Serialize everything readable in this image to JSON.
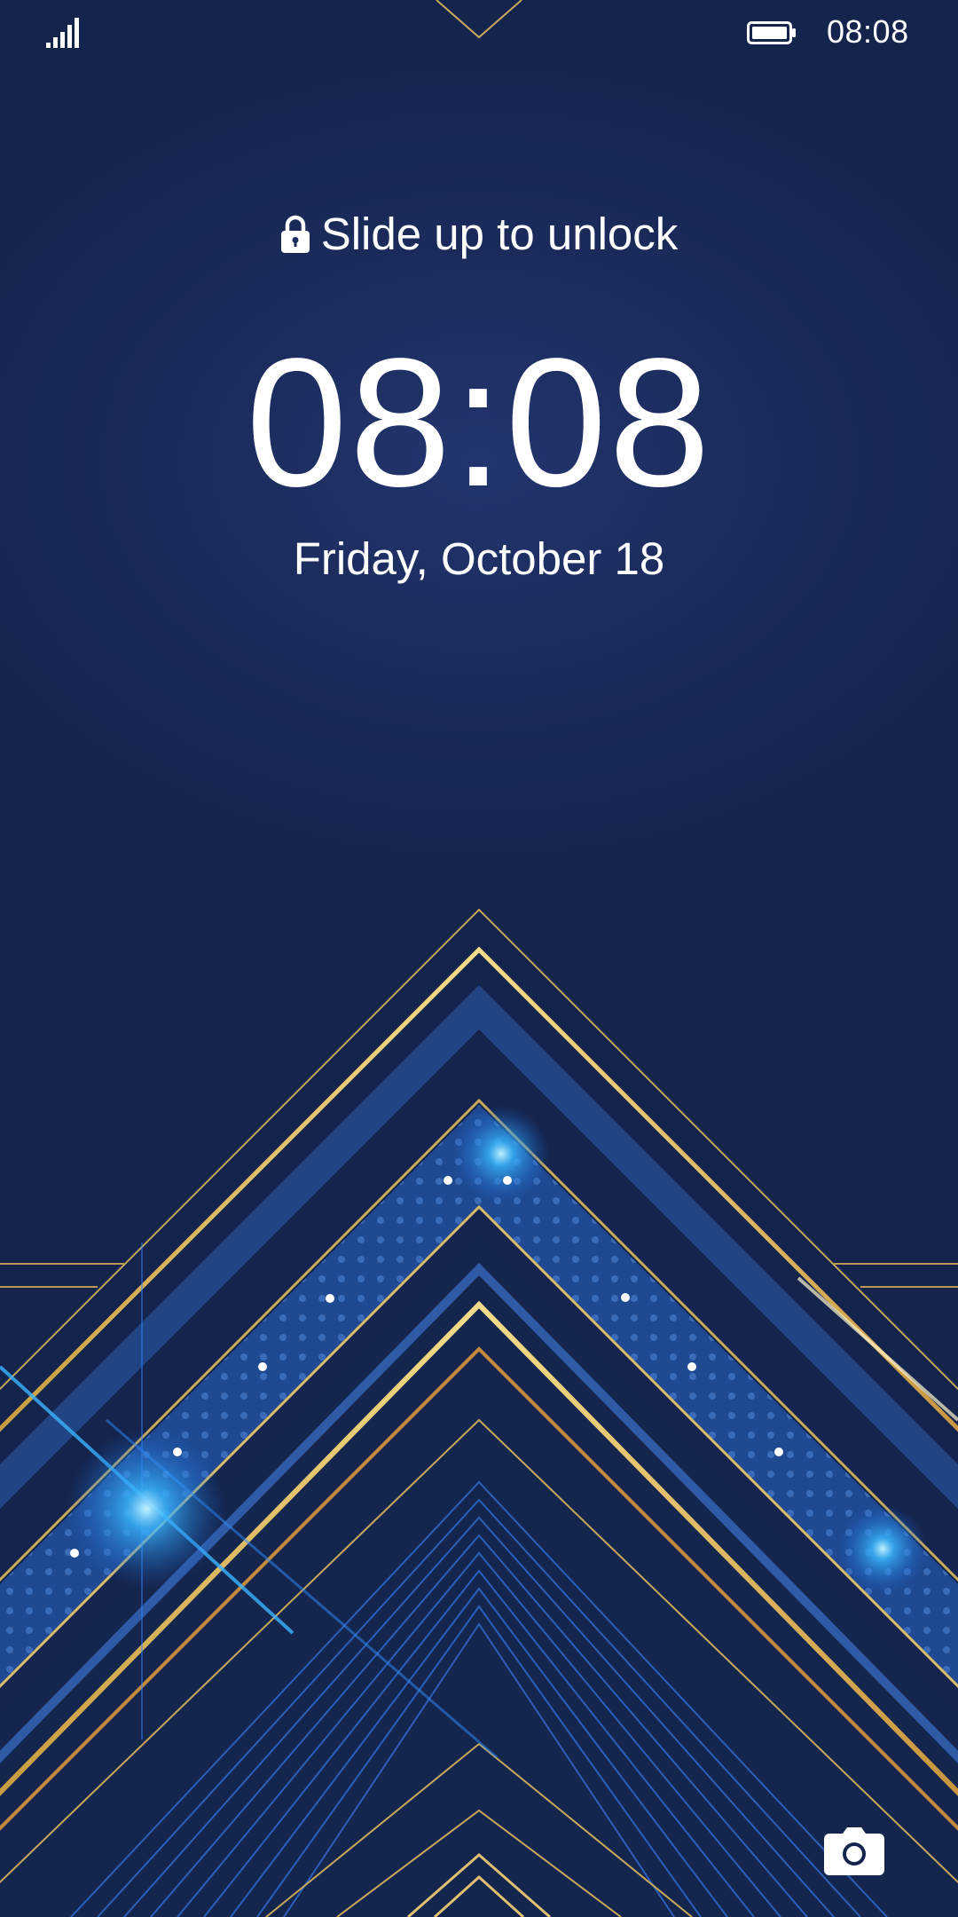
{
  "status_bar": {
    "time": "08:08",
    "signal_icon": "signal-bars-icon",
    "battery_icon": "battery-full-icon"
  },
  "lock_screen": {
    "unlock_hint": "Slide up to unlock",
    "lock_icon": "lock-icon",
    "clock": "08:08",
    "date": "Friday, October 18",
    "camera_icon": "camera-icon"
  },
  "colors": {
    "background": "#17264f",
    "accent_gold": "#e9c76a",
    "accent_blue": "#2a5bb0",
    "sparkle": "#36b9ff"
  }
}
